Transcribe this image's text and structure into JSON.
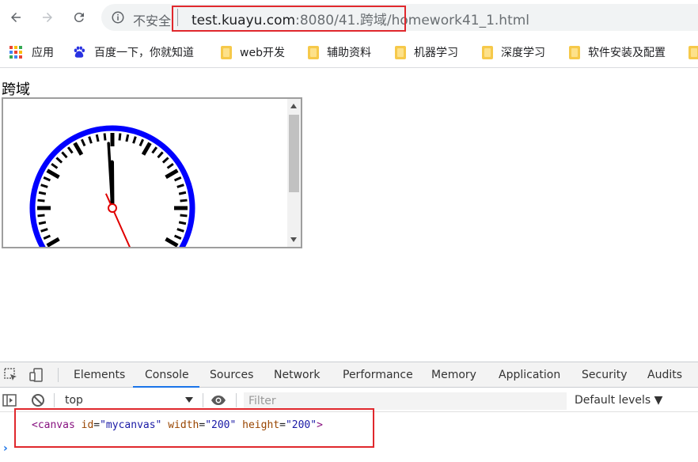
{
  "browser": {
    "insecure_label": "不安全",
    "url_host": "test.kuayu.com",
    "url_rest": ":8080/41.跨域/homework41_1.html"
  },
  "bookmarks": [
    {
      "label": "应用",
      "icon": "apps-grid-icon"
    },
    {
      "label": "百度一下，你就知道",
      "icon": "baidu-paw-icon"
    },
    {
      "label": "web开发",
      "icon": "folder-icon"
    },
    {
      "label": "辅助资料",
      "icon": "folder-icon"
    },
    {
      "label": "机器学习",
      "icon": "folder-icon"
    },
    {
      "label": "深度学习",
      "icon": "folder-icon"
    },
    {
      "label": "软件安装及配置",
      "icon": "folder-icon"
    }
  ],
  "page": {
    "title": "跨域"
  },
  "clock": {
    "hour": 11,
    "minute": 59,
    "second": 26,
    "rim_color": "#0000ff",
    "second_hand_color": "#e00000"
  },
  "devtools": {
    "tabs": [
      "Elements",
      "Console",
      "Sources",
      "Network",
      "Performance",
      "Memory",
      "Application",
      "Security",
      "Audits"
    ],
    "active_tab": "Console",
    "context": "top",
    "filter_placeholder": "Filter",
    "levels": "Default levels ▼",
    "log": {
      "tag_open": "<canvas",
      "attr1_name": "id",
      "attr1_value": "\"mycanvas\"",
      "attr2_name": "width",
      "attr2_value": "\"200\"",
      "attr3_name": "height",
      "attr3_value": "\"200\"",
      "tag_close": ">"
    },
    "prompt": "›"
  },
  "colors": {
    "highlight": "#e0282d",
    "accent": "#1a73e8"
  }
}
